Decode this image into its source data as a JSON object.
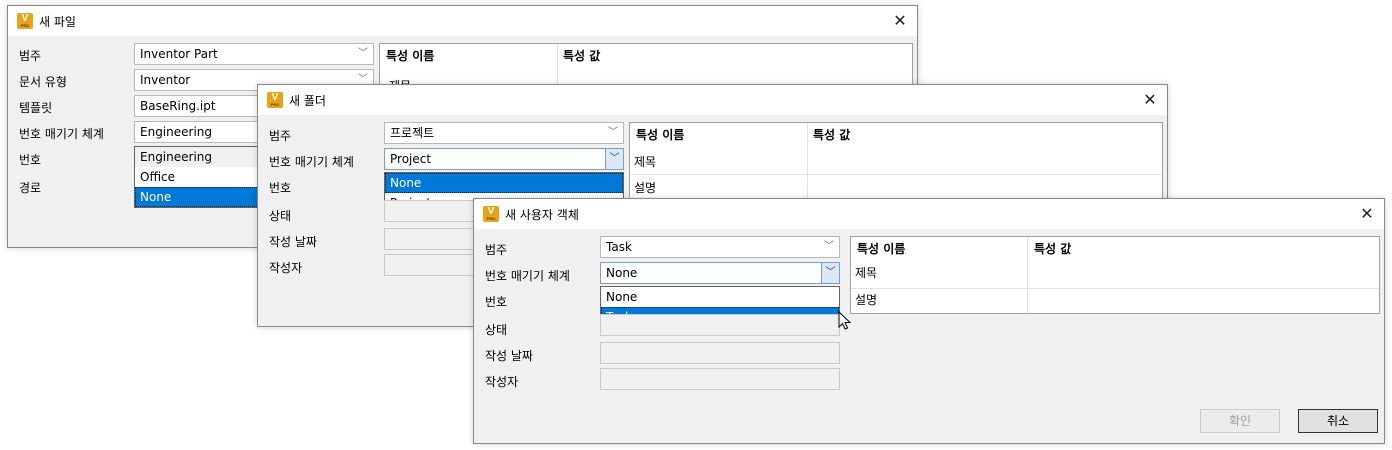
{
  "dialog1": {
    "title": "새 파일",
    "labels": {
      "category": "범주",
      "doc_type": "문서 유형",
      "template": "템플릿",
      "numbering": "번호 매기기 체계",
      "number": "번호",
      "path": "경로"
    },
    "fields": {
      "category": "Inventor Part",
      "doc_type": "Inventor",
      "template": "BaseRing.ipt",
      "numbering": "Engineering"
    },
    "dropdown": [
      "Engineering",
      "Office",
      "None"
    ],
    "dropdown_selected": "None",
    "grid": {
      "col_name": "특성 이름",
      "col_value": "특성 값",
      "rows": [
        "제목"
      ]
    }
  },
  "dialog2": {
    "title": "새 폴더",
    "labels": {
      "category": "범주",
      "numbering": "번호 매기기 체계",
      "number": "번호",
      "status": "상태",
      "created_date": "작성 날짜",
      "author": "작성자"
    },
    "fields": {
      "category": "프로젝트",
      "numbering": "Project"
    },
    "dropdown": [
      "None",
      "Project"
    ],
    "dropdown_selected": "None",
    "grid": {
      "col_name": "특성 이름",
      "col_value": "특성 값",
      "rows": [
        "제목",
        "설명"
      ]
    }
  },
  "dialog3": {
    "title": "새 사용자 객체",
    "labels": {
      "category": "범주",
      "numbering": "번호 매기기 체계",
      "number": "번호",
      "status": "상태",
      "created_date": "작성 날짜",
      "author": "작성자"
    },
    "fields": {
      "category": "Task",
      "numbering": "None"
    },
    "dropdown": [
      "None",
      "Task"
    ],
    "dropdown_selected": "Task",
    "grid": {
      "col_name": "특성 이름",
      "col_value": "특성 값",
      "rows": [
        "제목",
        "설명"
      ]
    },
    "buttons": {
      "ok": "확인",
      "cancel": "취소"
    }
  },
  "icons": {
    "app": "vault-app-icon",
    "close": "close-icon",
    "chevron": "chevron-down-icon",
    "cursor": "mouse-pointer-icon"
  },
  "colors": {
    "selection": "#0078d7",
    "app_icon": "#e8a317",
    "dialog_bg": "#f0f0f0"
  }
}
